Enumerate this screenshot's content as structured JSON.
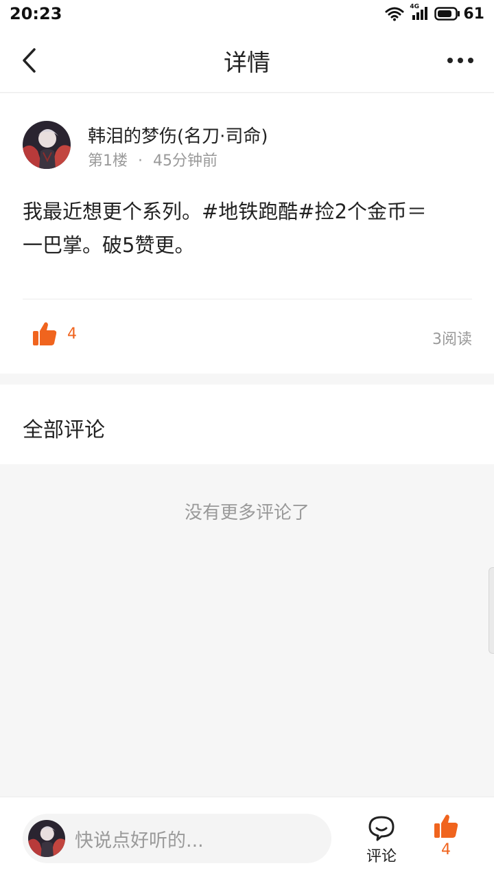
{
  "status_bar": {
    "time": "20:23",
    "network": "4G",
    "battery": "61"
  },
  "header": {
    "title": "详情"
  },
  "post": {
    "author": "韩泪的梦伤(名刀·司命)",
    "floor": "第1楼",
    "separator": "·",
    "time_ago": "45分钟前",
    "content_line1": "我最近想更个系列。#地铁跑酷#捡2个金币＝",
    "content_line2": "一巴掌。破5赞更。",
    "likes": "4",
    "reads": "3阅读"
  },
  "comments": {
    "title": "全部评论",
    "empty_text": "没有更多评论了"
  },
  "bottom_bar": {
    "input_placeholder": "快说点好听的...",
    "comment_label": "评论",
    "like_count": "4"
  },
  "colors": {
    "accent": "#f0641e",
    "text": "#222222",
    "muted": "#999999",
    "background": "#f6f6f6"
  }
}
